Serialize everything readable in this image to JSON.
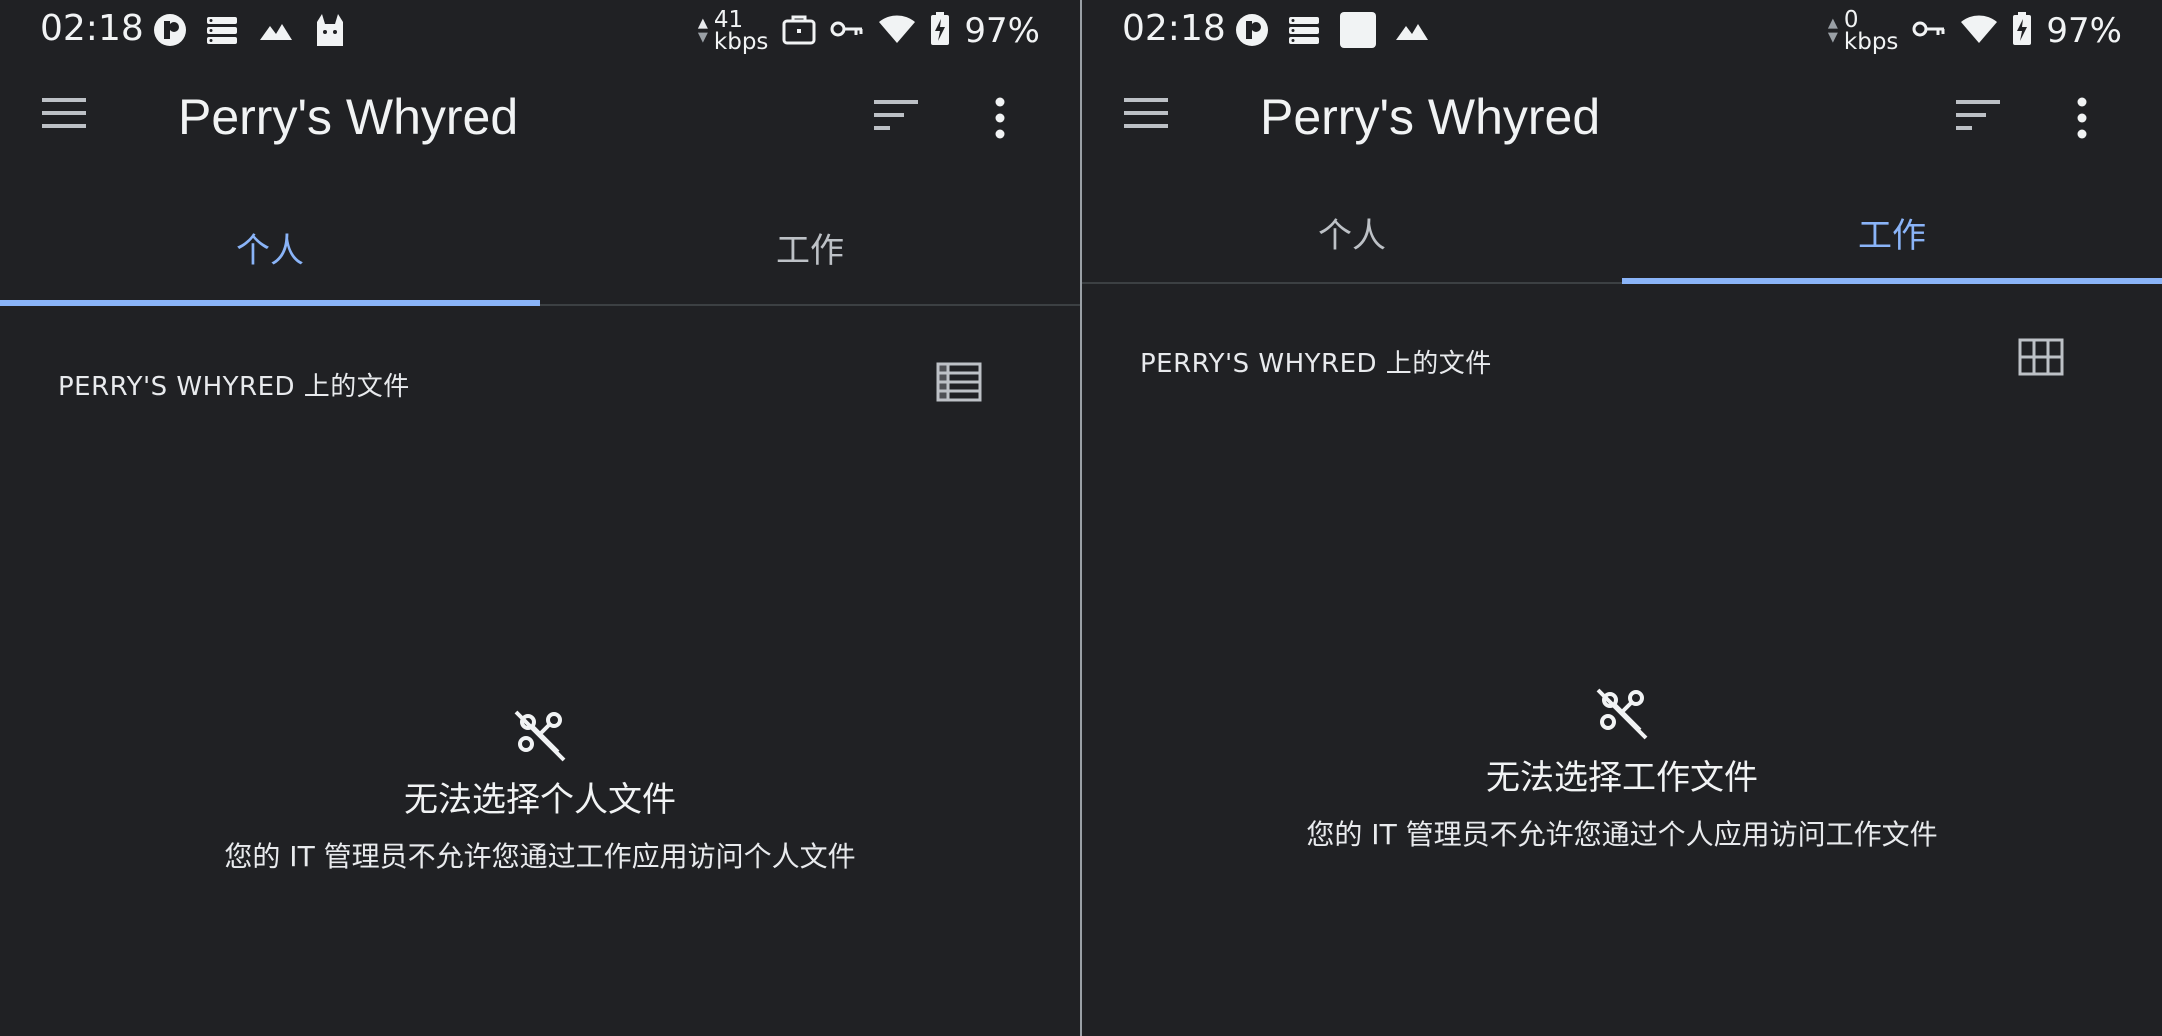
{
  "status_bar": {
    "time": "02:18",
    "battery_percent": "97%",
    "left_speed_value": "41",
    "right_speed_value": "0",
    "speed_unit": "kbps"
  },
  "app_bar": {
    "title": "Perry's Whyred"
  },
  "tabs": [
    {
      "label": "个人"
    },
    {
      "label": "工作"
    }
  ],
  "section_title": "PERRY'S WHYRED 上的文件",
  "left_panel": {
    "active_tab": "个人",
    "empty_title": "无法选择个人文件",
    "empty_message": "您的 IT 管理员不允许您通过工作应用访问个人文件"
  },
  "right_panel": {
    "active_tab": "工作",
    "empty_title": "无法选择工作文件",
    "empty_message": "您的 IT 管理员不允许您通过个人应用访问工作文件"
  },
  "colors": {
    "background": "#202124",
    "accent": "#8ab4f8",
    "text": "#e8eaed"
  },
  "icons": [
    "menu-icon",
    "sort-icon",
    "more-vert-icon",
    "list-view-icon",
    "grid-view-icon",
    "cross-profile-blocked-icon",
    "briefcase-icon",
    "vpn-key-icon",
    "wifi-icon",
    "battery-charging-icon"
  ]
}
